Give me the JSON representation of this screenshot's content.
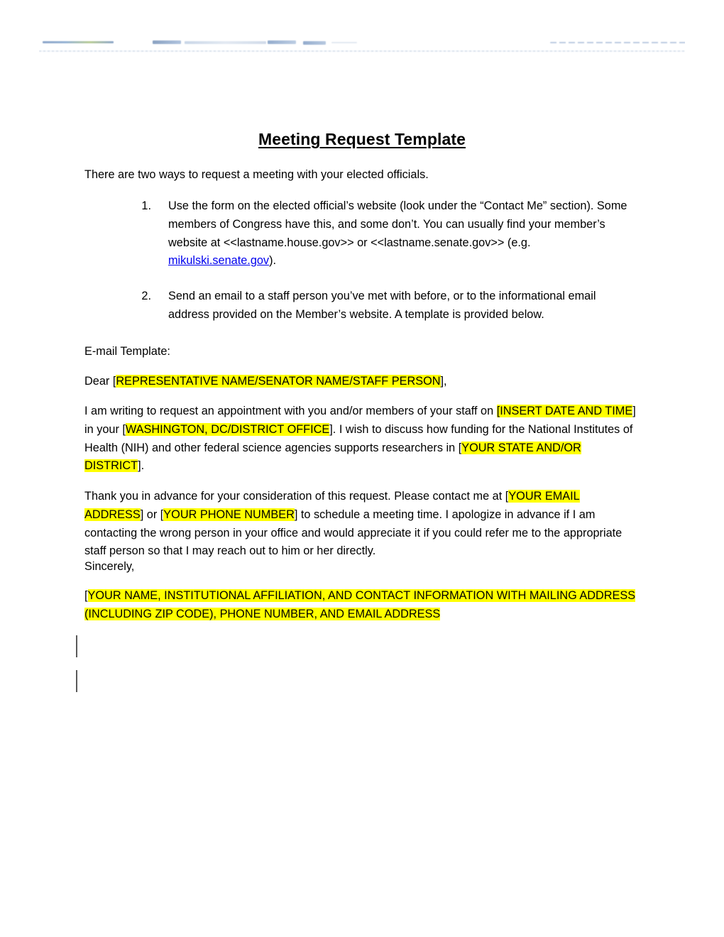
{
  "document": {
    "title": "Meeting Request Template",
    "intro": "There are two ways to request a meeting with your elected officials.",
    "steps": [
      {
        "number": "1.",
        "text_before_link": "Use the form on the elected official’s website (look under the “Contact Me” section). Some members of Congress have this, and some don’t. You can usually find your member’s website at <<lastname.house.gov>> or <<lastname.senate.gov>> (e.g. ",
        "link_text": "mikulski.senate.gov",
        "text_after_link": ")."
      },
      {
        "number": "2.",
        "text": "Send an email to a staff person you’ve met with before, or to the informational email address provided on the Member’s website. A template is provided below."
      }
    ],
    "email_template_label": "E-mail Template:",
    "salutation": {
      "prefix": "Dear [",
      "field": "REPRESENTATIVE NAME/SENATOR NAME/STAFF PERSON",
      "suffix": "],"
    },
    "body_paragraph_1": {
      "seg1": "I am writing to request an appointment with you and/or members of your staff on ",
      "field1": "[INSERT DATE AND TIME",
      "seg2": "] in your [",
      "field2": "WASHINGTON, DC/DISTRICT OFFICE",
      "seg3": "]. I wish to discuss how funding for the National Institutes of Health (NIH) and other federal science agencies supports researchers in [",
      "field3": "YOUR STATE AND/OR DISTRICT",
      "seg4": "]."
    },
    "body_paragraph_2": {
      "seg1": "Thank you in advance for your consideration of this request. Please contact me at [",
      "field1": "YOUR EMAIL ADDRESS",
      "seg2": "] or [",
      "field2": "YOUR PHONE NUMBER",
      "seg3": "] to schedule a meeting time. I apologize in advance if I am contacting the wrong person in your office and would appreciate it if you could refer me to the appropriate staff person so that I may reach out to him or her directly."
    },
    "closing": "Sincerely,",
    "signature_block": {
      "prefix": "[",
      "field": "YOUR NAME, INSTITUTIONAL AFFILIATION, AND CONTACT INFORMATION WITH MAILING ADDRESS (INCLUDING ZIP CODE), PHONE NUMBER, AND EMAIL ADDRESS"
    }
  },
  "colors": {
    "highlight": "#ffff00",
    "link": "#0000ee",
    "text": "#000000",
    "change_bar": "#5a5a5a",
    "page_background": "#ffffff"
  }
}
